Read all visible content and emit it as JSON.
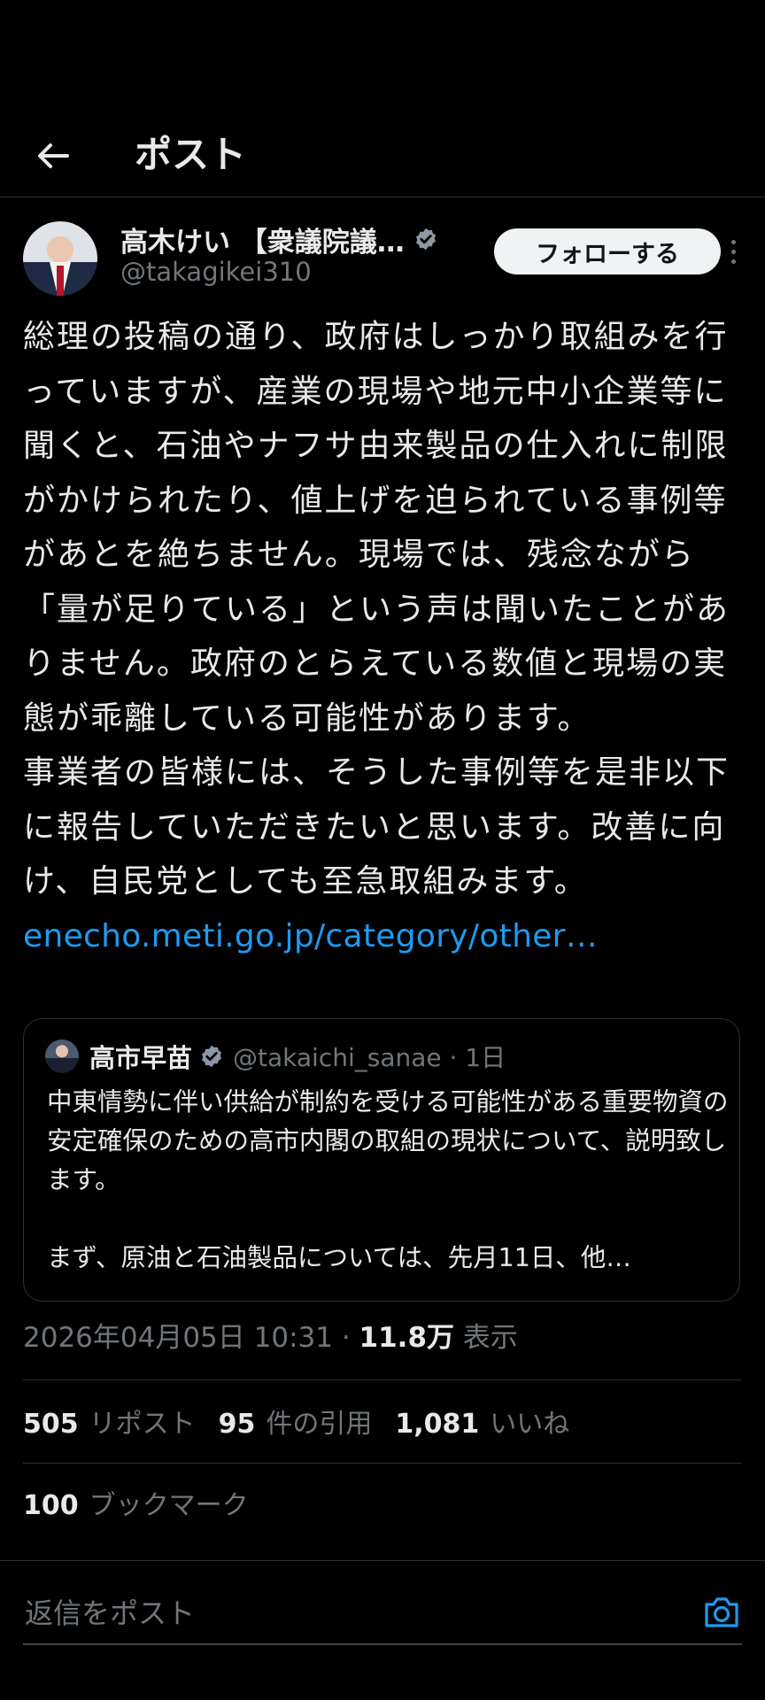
{
  "header": {
    "title": "ポスト"
  },
  "author": {
    "display_name": "高木けい 【衆議院議…",
    "handle": "@takagikei310",
    "follow_label": "フォローする"
  },
  "post": {
    "paragraph1": "総理の投稿の通り、政府はしっかり取組みを行っていますが、産業の現場や地元中小企業等に聞くと、石油やナフサ由来製品の仕入れに制限がかけられたり、値上げを迫られている事例等があとを絶ちません。現場では、残念ながら「量が足りている」という声は聞いたことがありません。政府のとらえている数値と現場の実態が乖離している可能性があります。",
    "paragraph2": "事業者の皆様には、そうした事例等を是非以下に報告していただきたいと思います。改善に向け、自民党としても至急取組みます。",
    "link": "enecho.meti.go.jp/category/other…"
  },
  "quote": {
    "name": "高市早苗",
    "handle": "@takaichi_sanae · 1日",
    "text1": "中東情勢に伴い供給が制約を受ける可能性がある重要物資の安定確保のための高市内閣の取組の現状について、説明致します。",
    "text2": "まず、原油と石油製品については、先月11日、他…"
  },
  "meta": {
    "timestamp": "2026年04月05日 10:31 · ",
    "views_count": "11.8万",
    "views_label": " 表示"
  },
  "stats": {
    "reposts_count": "505",
    "reposts_label": "リポスト",
    "quotes_count": "95",
    "quotes_label": "件の引用",
    "likes_count": "1,081",
    "likes_label": "いいね",
    "bookmarks_count": "100",
    "bookmarks_label": "ブックマーク"
  },
  "reply": {
    "placeholder": "返信をポスト"
  },
  "colors": {
    "accent": "#1d9bf0",
    "background": "#000000",
    "muted": "#71767b",
    "verified": "#8b98a5"
  }
}
